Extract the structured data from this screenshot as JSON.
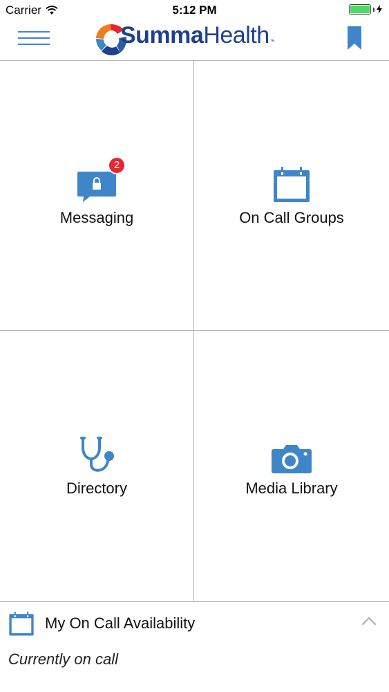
{
  "status_bar": {
    "carrier": "Carrier",
    "time": "5:12 PM",
    "battery_color": "#4cd964"
  },
  "nav": {
    "menu_icon": "hamburger-menu-icon",
    "logo_text_bold": "Summa",
    "logo_text_light": "Health",
    "logo_tm": "™",
    "brand_color": "#1f3f8f",
    "accent_color": "#3f86c8",
    "bookmark_icon": "bookmark-icon"
  },
  "tiles": [
    {
      "label": "Messaging",
      "icon": "secure-message-icon",
      "badge": "2"
    },
    {
      "label": "On Call Groups",
      "icon": "calendar-icon"
    },
    {
      "label": "Directory",
      "icon": "stethoscope-icon"
    },
    {
      "label": "Media Library",
      "icon": "camera-icon"
    }
  ],
  "badge_color": "#e8262f",
  "availability": {
    "title": "My On Call Availability",
    "status": "Currently on call",
    "icon": "calendar-icon",
    "toggle_icon": "chevron-up-icon"
  }
}
